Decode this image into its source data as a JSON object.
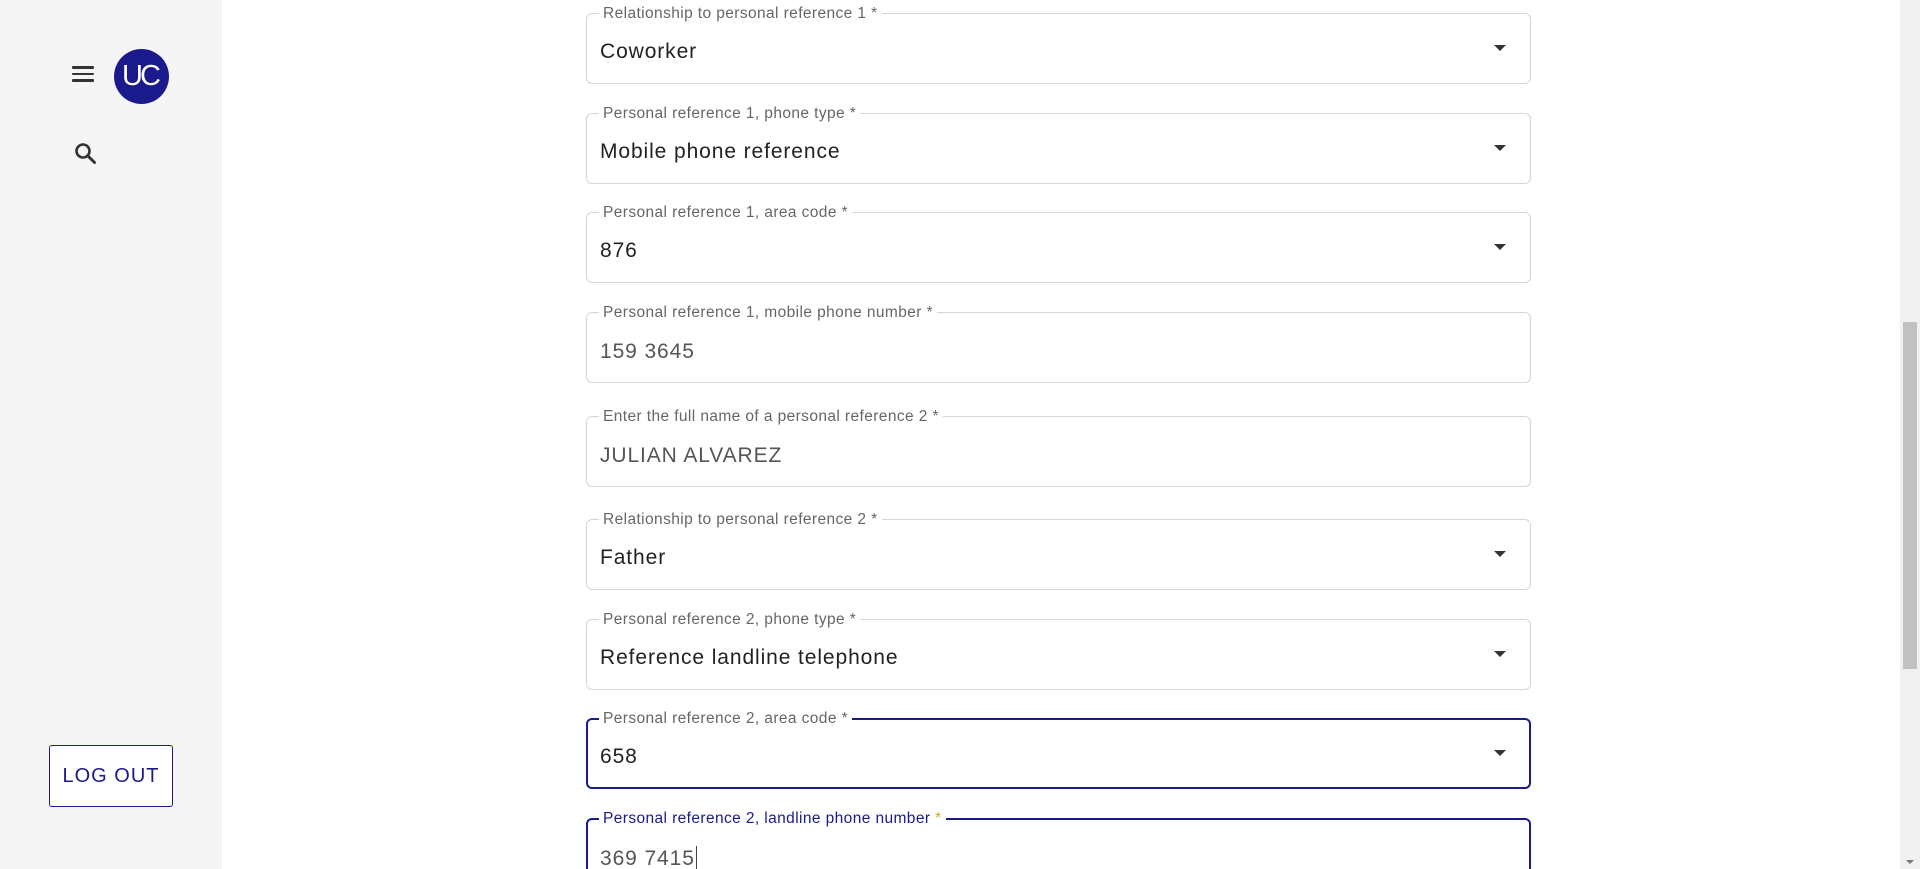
{
  "sidebar": {
    "avatar_initials": "UC",
    "avatar_color": "#1a1a8c",
    "menu_icon": "hamburger-menu-icon",
    "search_icon": "search-icon",
    "logout_label": "LOG OUT"
  },
  "form": {
    "accent_color": "#1a1a8c",
    "required_marker_color": "#e0a010",
    "fields": [
      {
        "label": "Relationship to personal reference 1",
        "required": "*",
        "value": "Coworker",
        "type": "select"
      },
      {
        "label": "Personal reference 1, phone type",
        "required": "*",
        "value": "Mobile phone reference",
        "type": "select"
      },
      {
        "label": "Personal reference 1, area code",
        "required": "*",
        "value": "876",
        "type": "select"
      },
      {
        "label": "Personal reference 1, mobile phone number",
        "required": "*",
        "value": "159 3645",
        "type": "text"
      },
      {
        "label": "Enter the full name of a personal reference 2",
        "required": "*",
        "value": "JULIAN ALVAREZ",
        "type": "text"
      },
      {
        "label": "Relationship to personal reference 2",
        "required": "*",
        "value": "Father",
        "type": "select"
      },
      {
        "label": "Personal reference 2, phone type",
        "required": "*",
        "value": "Reference landline telephone",
        "type": "select"
      },
      {
        "label": "Personal reference 2, area code",
        "required": "*",
        "value": "658",
        "type": "select"
      },
      {
        "label": "Personal reference 2, landline phone number",
        "required": "*",
        "value": "369 7415",
        "type": "text"
      }
    ]
  }
}
